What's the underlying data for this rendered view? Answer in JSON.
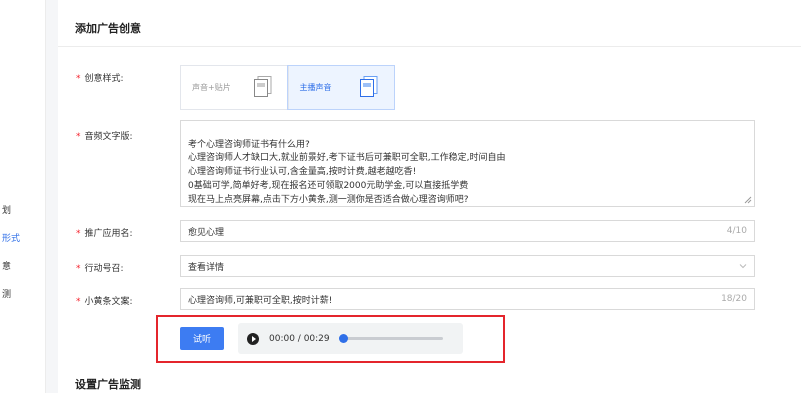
{
  "sidebar": {
    "items": [
      {
        "label": "划",
        "active": false
      },
      {
        "label": "形式",
        "active": true
      },
      {
        "label": "意",
        "active": false
      },
      {
        "label": "测",
        "active": false
      }
    ]
  },
  "section_title": "添加广告创意",
  "section2_title": "设置广告监测",
  "form": {
    "style": {
      "label": "创意样式:",
      "options": [
        {
          "label": "声音+贴片",
          "selected": false
        },
        {
          "label": "主播声音",
          "selected": true
        }
      ]
    },
    "audio_text": {
      "label": "音频文字版:",
      "value": "考个心理咨询师证书有什么用?\n心理咨询师人才缺口大,就业前景好,考下证书后可兼职可全职,工作稳定,时间自由\n心理咨询师证书行业认可,含金量高,按时计费,越老越吃香!\n0基础可学,简单好考,现在报名还可领取2000元助学金,可以直接抵学费\n现在马上点亮屏幕,点击下方小黄条,测一测你是否适合做心理咨询师吧?"
    },
    "app_name": {
      "label": "推广应用名:",
      "value": "愈见心理",
      "count": "4/10"
    },
    "cta": {
      "label": "行动号召:",
      "value": "查看详情"
    },
    "banner": {
      "label": "小黄条文案:",
      "value": "心理咨询师,可兼职可全职,按时计薪!",
      "count": "18/20"
    }
  },
  "player": {
    "try_label": "试听",
    "time": "00:00  /  00:29",
    "progress": 0
  },
  "colors": {
    "accent": "#2f6fe8",
    "required": "#f5222d",
    "highlight": "#e4252c"
  }
}
